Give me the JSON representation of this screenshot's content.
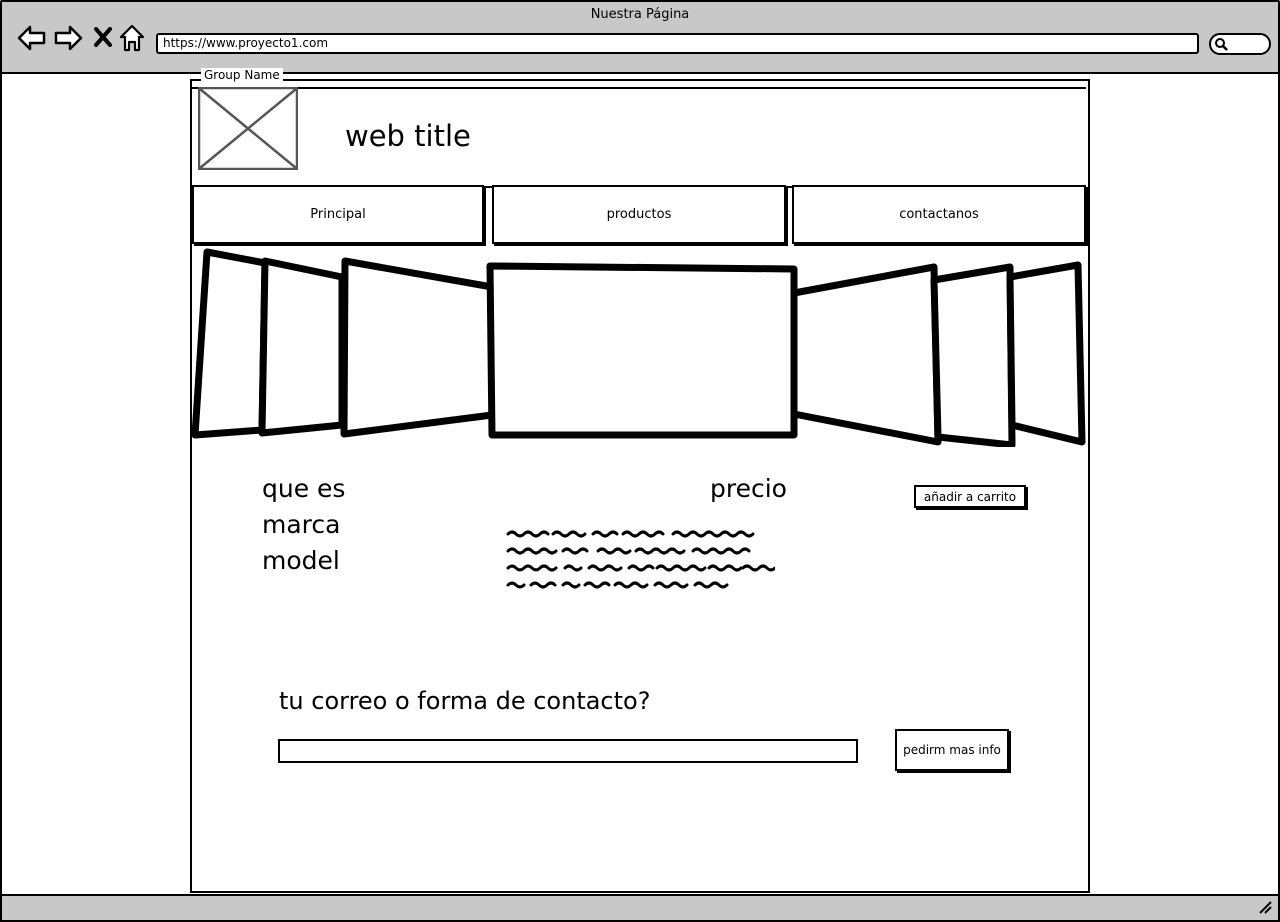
{
  "window": {
    "title": "Nuestra Página",
    "url": "https://www.proyecto1.com"
  },
  "icons": {
    "back": "arrow-left-icon",
    "forward": "arrow-right-icon",
    "stop": "close-icon",
    "home": "home-icon",
    "search": "search-icon",
    "logo": "image-placeholder-icon"
  },
  "group": {
    "label": "Group Name"
  },
  "header": {
    "title": "web title"
  },
  "nav": {
    "tabs": [
      {
        "label": "Principal"
      },
      {
        "label": "productos"
      },
      {
        "label": "contactanos"
      }
    ]
  },
  "product": {
    "info_lines": [
      "que es",
      "marca",
      "model"
    ],
    "price_label": "precio",
    "cart_button": "añadir a carrito"
  },
  "contact": {
    "question": "tu correo o forma de contacto?",
    "input_value": "",
    "input_placeholder": "",
    "button_label": "pedirm mas info"
  },
  "colors": {
    "chrome": "#c8c8c8",
    "ink": "#000000",
    "background": "#ffffff",
    "placeholder_stroke": "#555555"
  }
}
